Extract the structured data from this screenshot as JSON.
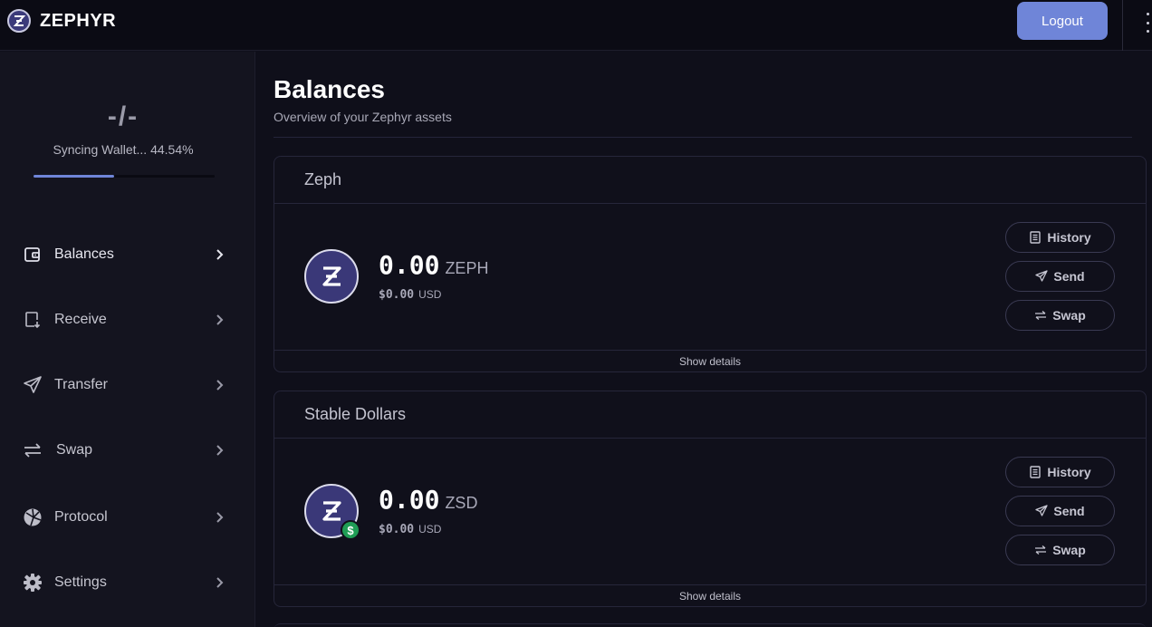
{
  "brand": {
    "name": "ZEPHYR"
  },
  "topbar": {
    "logout_label": "Logout"
  },
  "sidebar": {
    "sync_value": "-/-",
    "sync_text": "Syncing Wallet... 44.54%",
    "sync_progress_percent": 44.54,
    "items": [
      {
        "label": "Balances",
        "icon": "wallet-icon"
      },
      {
        "label": "Receive",
        "icon": "receive-icon"
      },
      {
        "label": "Transfer",
        "icon": "send-icon"
      },
      {
        "label": "Swap",
        "icon": "swap-icon"
      },
      {
        "label": "Protocol",
        "icon": "protocol-icon"
      },
      {
        "label": "Settings",
        "icon": "gear-icon"
      }
    ]
  },
  "main": {
    "title": "Balances",
    "subtitle": "Overview of your Zephyr assets",
    "cards": [
      {
        "title": "Zeph",
        "amount": "0.00",
        "unit": "ZEPH",
        "fiat_value": "$0.00",
        "fiat_unit": "USD",
        "actions": [
          "History",
          "Send",
          "Swap"
        ],
        "footer": "Show details"
      },
      {
        "title": "Stable Dollars",
        "amount": "0.00",
        "unit": "ZSD",
        "fiat_value": "$0.00",
        "fiat_unit": "USD",
        "actions": [
          "History",
          "Send",
          "Swap"
        ],
        "footer": "Show details"
      }
    ]
  },
  "colors": {
    "accent": "#6f85d8",
    "background": "#0f0f1a",
    "stable_badge": "#1f9d55"
  }
}
